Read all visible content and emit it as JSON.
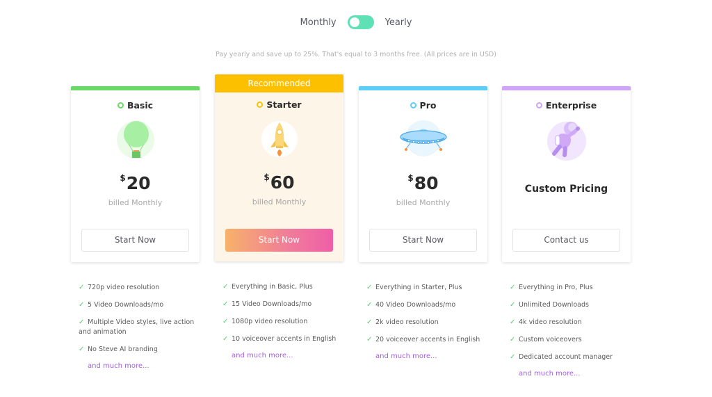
{
  "billing_toggle": {
    "monthly_label": "Monthly",
    "yearly_label": "Yearly",
    "state": "monthly",
    "color": "#5fe0b5"
  },
  "note": "Pay yearly and save up to 25%. That's equal to 3 months free. (All prices are in USD)",
  "plans": [
    {
      "name": "Basic",
      "accent": "#6ad866",
      "illustration": "hot-air-balloon-icon",
      "currency": "$",
      "price": "20",
      "billing": "billed Monthly",
      "cta": "Start Now",
      "features": [
        "720p video resolution",
        "5 Video Downloads/mo",
        "Multiple Video styles, live action and animation",
        "No Steve AI branding"
      ],
      "more": "and much more..."
    },
    {
      "name": "Starter",
      "badge": "Recommended",
      "accent": "#fcc000",
      "illustration": "rocket-icon",
      "currency": "$",
      "price": "60",
      "billing": "billed Monthly",
      "cta": "Start Now",
      "features": [
        "Everything in Basic, Plus",
        "15 Video Downloads/mo",
        "1080p video resolution",
        "10 voiceover accents in English"
      ],
      "more": "and much more..."
    },
    {
      "name": "Pro",
      "accent": "#5bcdf7",
      "illustration": "ufo-icon",
      "currency": "$",
      "price": "80",
      "billing": "billed Monthly",
      "cta": "Start Now",
      "features": [
        "Everything in Starter, Plus",
        "40 Video Downloads/mo",
        "2k video resolution",
        "20 voiceover accents in English"
      ],
      "more": "and much more..."
    },
    {
      "name": "Enterprise",
      "accent": "#cfa3f5",
      "illustration": "astronaut-icon",
      "price_text": "Custom Pricing",
      "cta": "Contact us",
      "features": [
        "Everything in Pro, Plus",
        "Unlimited Downloads",
        "4k video resolution",
        "Custom voiceovers",
        "Dedicated account manager"
      ],
      "more": "and much more..."
    }
  ],
  "icons": {
    "check": "✓"
  }
}
